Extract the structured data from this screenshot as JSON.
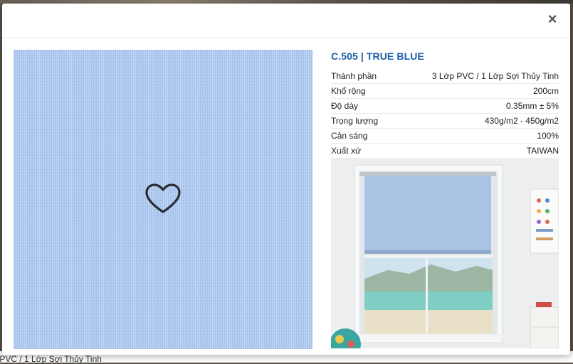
{
  "modal": {
    "close_label": "×",
    "product": {
      "title": "C.505 | TRUE BLUE",
      "specs": [
        {
          "label": "Thành phần",
          "value": "3 Lớp PVC / 1 Lớp Sợi Thủy Tinh"
        },
        {
          "label": "Khổ rộng",
          "value": "200cm"
        },
        {
          "label": "Độ dày",
          "value": "0.35mm ± 5%"
        },
        {
          "label": "Trọng lượng",
          "value": "430g/m2 - 450g/m2"
        },
        {
          "label": "Cản sáng",
          "value": "100%"
        },
        {
          "label": "Xuất xứ",
          "value": "TAIWAN"
        }
      ]
    },
    "swatch_color": "#a9c5ee",
    "icons": {
      "favorite": "heart-icon",
      "close": "close-icon"
    }
  },
  "backdrop": {
    "partial_text": "- PVC / 1 Lớp Sợi Thủy Tinh"
  }
}
